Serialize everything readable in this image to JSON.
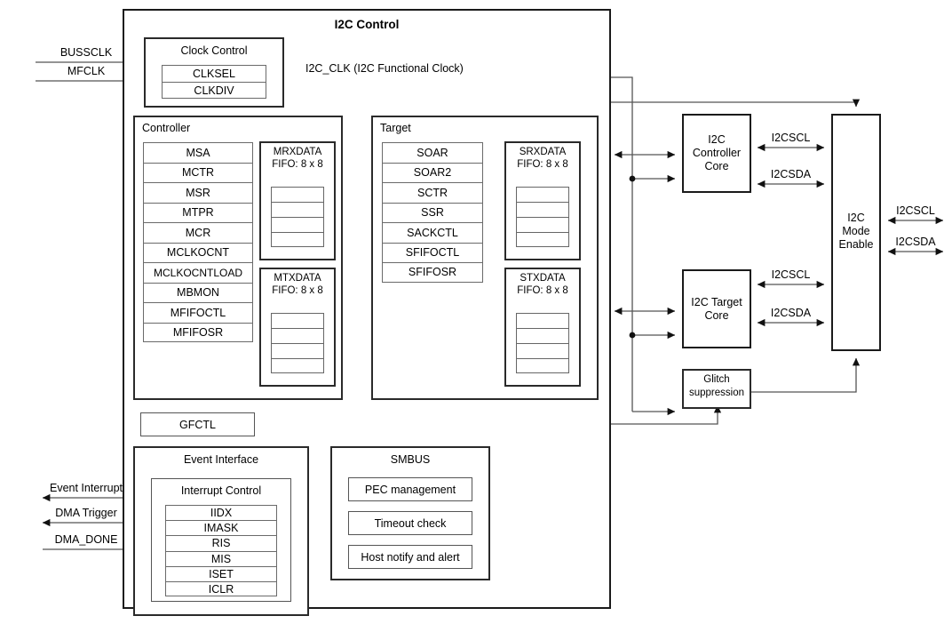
{
  "diagram": {
    "title": "I2C Control",
    "type": "block-diagram"
  },
  "inputs": {
    "bussclk": "BUSSCLK",
    "mfclk": "MFCLK",
    "dma_done": "DMA_DONE"
  },
  "outputs": {
    "event_interrupt": "Event Interrupt",
    "dma_trigger": "DMA Trigger",
    "ext_scl": "I2CSCL",
    "ext_sda": "I2CSDA"
  },
  "clock_control": {
    "title": "Clock Control",
    "registers": [
      "CLKSEL",
      "CLKDIV"
    ],
    "output_label": "I2C_CLK (I2C Functional Clock)"
  },
  "controller": {
    "title": "Controller",
    "registers": [
      "MSA",
      "MCTR",
      "MSR",
      "MTPR",
      "MCR",
      "MCLKOCNT",
      "MCLKOCNTLOAD",
      "MBMON",
      "MFIFOCTL",
      "MFIFOSR"
    ],
    "fifos": [
      {
        "name": "MRXDATA",
        "size": "FIFO: 8 x 8",
        "slots": 4
      },
      {
        "name": "MTXDATA",
        "size": "FIFO: 8 x 8",
        "slots": 4
      }
    ]
  },
  "target": {
    "title": "Target",
    "registers": [
      "SOAR",
      "SOAR2",
      "SCTR",
      "SSR",
      "SACKCTL",
      "SFIFOCTL",
      "SFIFOSR"
    ],
    "fifos": [
      {
        "name": "SRXDATA",
        "size": "FIFO: 8 x 8",
        "slots": 4
      },
      {
        "name": "STXDATA",
        "size": "FIFO: 8 x 8",
        "slots": 4
      }
    ]
  },
  "gfctl": {
    "label": "GFCTL"
  },
  "event_interface": {
    "title": "Event Interface",
    "interrupt_control": {
      "title": "Interrupt Control",
      "registers": [
        "IIDX",
        "IMASK",
        "RIS",
        "MIS",
        "ISET",
        "ICLR"
      ]
    }
  },
  "smbus": {
    "title": "SMBUS",
    "items": [
      "PEC management",
      "Timeout check",
      "Host notify and alert"
    ]
  },
  "cores": {
    "controller_core": "I2C\nController\nCore",
    "controller_core_lines": [
      "I2C",
      "Controller",
      "Core"
    ],
    "target_core_lines": [
      "I2C Target",
      "Core"
    ],
    "glitch_lines": [
      "Glitch",
      "suppression"
    ],
    "mode_enable_lines": [
      "I2C",
      "Mode",
      "Enable"
    ]
  },
  "bus_labels": {
    "ctrl_scl": "I2CSCL",
    "ctrl_sda": "I2CSDA",
    "tgt_scl": "I2CSCL",
    "tgt_sda": "I2CSDA",
    "out_scl": "I2CSCL",
    "out_sda": "I2CSDA"
  },
  "colors": {
    "line": "#555555",
    "heavy": "#1a1a1a",
    "background": "#ffffff"
  }
}
